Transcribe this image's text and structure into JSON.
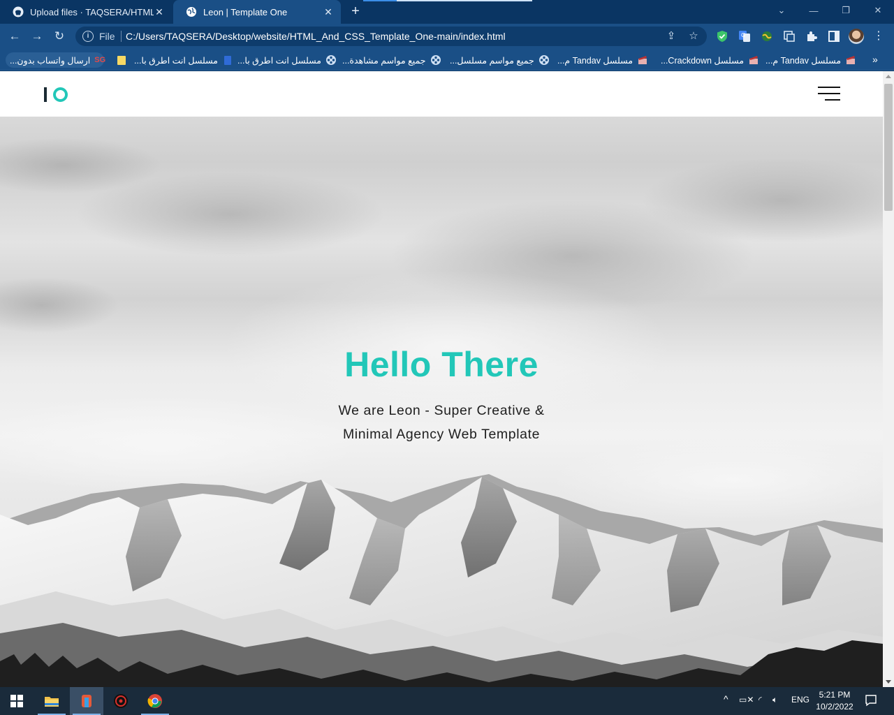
{
  "browser": {
    "tabs": [
      {
        "title": "Upload files · TAQSERA/HTML_An",
        "active": false,
        "favicon": "github-icon"
      },
      {
        "title": "Leon | Template One",
        "active": true,
        "favicon": "globe-icon"
      }
    ],
    "address": {
      "scheme_label": "File",
      "url": "C:/Users/TAQSERA/Desktop/website/HTML_And_CSS_Template_One-main/index.html"
    },
    "bookmarks": [
      {
        "label": "ارسال واتساب بدون...",
        "icon": "sg-icon"
      },
      {
        "label": "",
        "icon": "folder-icon"
      },
      {
        "label": "مسلسل انت اطرق با...",
        "icon": "doc-icon"
      },
      {
        "label": "مسلسل انت اطرق با...",
        "icon": "film-reel-icon"
      },
      {
        "label": "جميع مواسم مشاهدة...",
        "icon": "film-reel-icon"
      },
      {
        "label": "جميع مواسم مسلسل...",
        "icon": "film-reel-icon"
      },
      {
        "label": "مسلسل Tandav م...",
        "icon": "clapper-icon"
      },
      {
        "label": "مسلسل Crackdown...",
        "icon": "clapper-icon"
      },
      {
        "label": "مسلسل Tandav م...",
        "icon": "clapper-icon"
      }
    ],
    "bookmarks_more": "»"
  },
  "site": {
    "logo": "lO",
    "hero": {
      "title": "Hello There",
      "subtitle_line1": "We are Leon - Super Creative &",
      "subtitle_line2": "Minimal Agency Web Template"
    }
  },
  "taskbar": {
    "apps": [
      "start-icon",
      "file-explorer-icon",
      "app-icon",
      "antivirus-icon",
      "chrome-icon"
    ],
    "language": "ENG",
    "time": "5:21 PM",
    "date": "10/2/2022"
  },
  "colors": {
    "accent": "#22c7b8",
    "chrome_frame": "#0a3563",
    "chrome_toolbar": "#1a4f86",
    "taskbar": "#1a2b3b"
  }
}
